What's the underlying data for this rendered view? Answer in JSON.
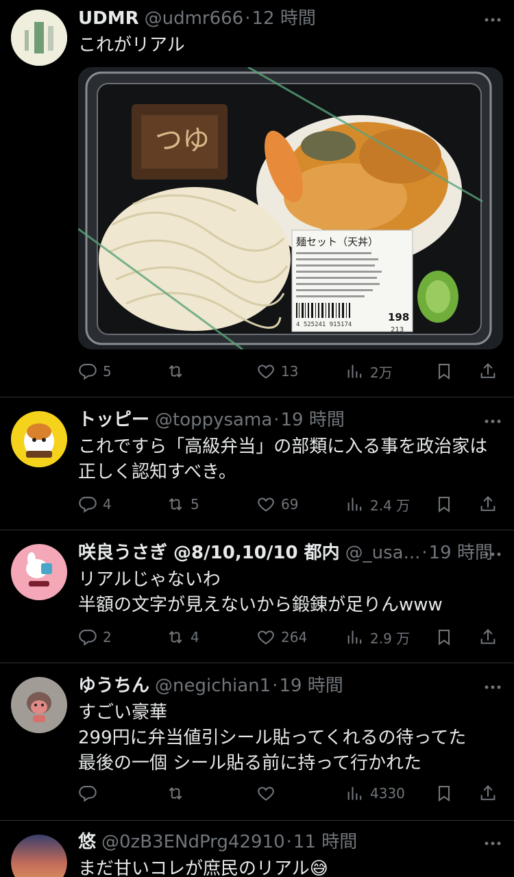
{
  "tweets": [
    {
      "name": "UDMR",
      "handle": "@udmr666",
      "time": "12 時間",
      "lines": [
        "これがリアル"
      ],
      "stats": {
        "replies": "5",
        "retweets": "",
        "likes": "13",
        "views": "2万"
      },
      "media": {
        "label_title": "麺セット（天丼）",
        "price": "198",
        "price_tax": "213",
        "barcode_number": "4 525241 915174",
        "sauce_label": "つゆ"
      }
    },
    {
      "name": "トッピー",
      "handle": "@toppysama",
      "time": "19 時間",
      "lines": [
        "これですら「高級弁当」の部類に入る事を政治家は",
        "正しく認知すべき。"
      ],
      "stats": {
        "replies": "4",
        "retweets": "5",
        "likes": "69",
        "views": "2.4 万"
      }
    },
    {
      "name": "咲良うさぎ @8/10,10/10 都内",
      "handle": "@_usa...",
      "time": "19 時間",
      "lines": [
        "リアルじゃないわ",
        "半額の文字が見えないから鍛錬が足りんwww"
      ],
      "stats": {
        "replies": "2",
        "retweets": "4",
        "likes": "264",
        "views": "2.9 万"
      }
    },
    {
      "name": "ゆうちん",
      "handle": "@negichian1",
      "time": "19 時間",
      "lines": [
        "すごい豪華",
        "299円に弁当値引シール貼ってくれるの待ってた",
        "最後の一個 シール貼る前に持って行かれた"
      ],
      "stats": {
        "replies": "",
        "retweets": "",
        "likes": "",
        "views": "4330"
      }
    },
    {
      "name": "悠",
      "handle": "@0zB3ENdPrg42910",
      "time": "11 時間",
      "lines": [
        "まだ甘いコレが庶民のリアル😅"
      ],
      "stats": {
        "replies": "",
        "retweets": "",
        "likes": "",
        "views": ""
      }
    }
  ],
  "icons": {
    "reply": "reply-icon",
    "retweet": "retweet-icon",
    "like": "heart-icon",
    "views": "views-icon",
    "bookmark": "bookmark-icon",
    "share": "share-icon",
    "more": "more-icon"
  },
  "colors": {
    "background": "#000000",
    "text": "#e7e9ea",
    "muted": "#71767b",
    "divider": "#2f3336"
  }
}
